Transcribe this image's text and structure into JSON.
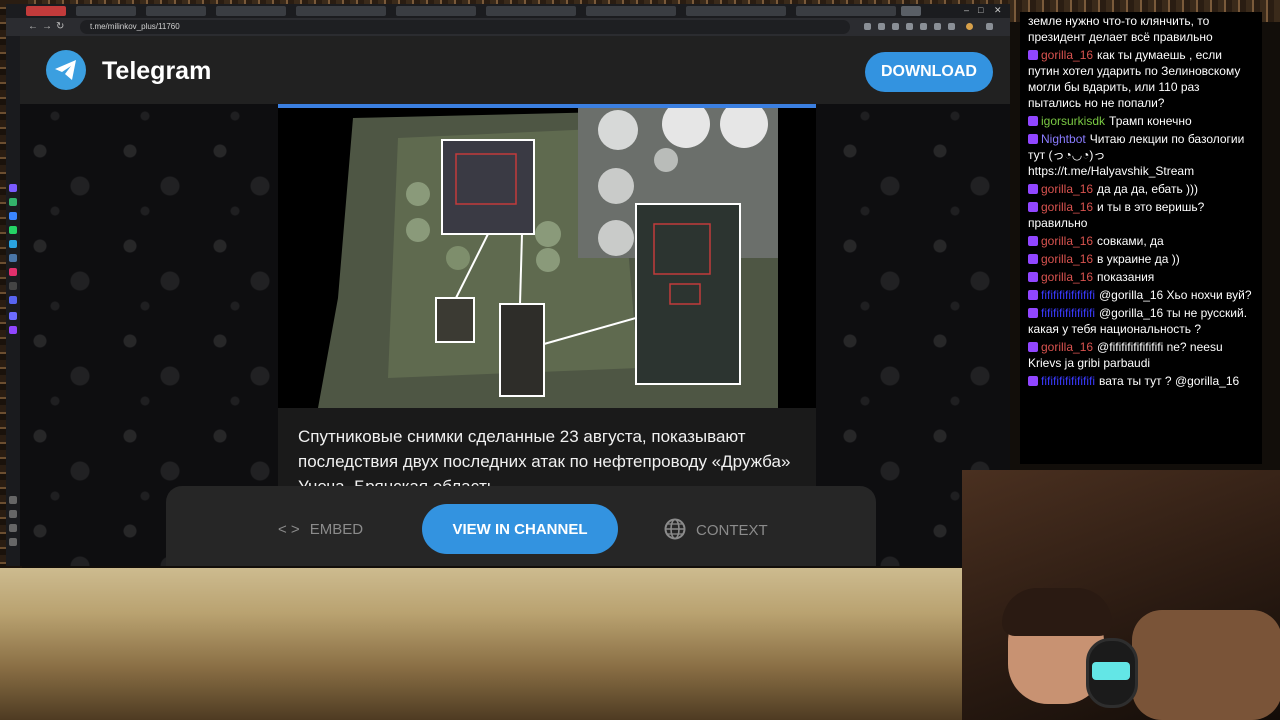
{
  "browser": {
    "url": "t.me/milinkov_plus/11760"
  },
  "telegram": {
    "brand": "Telegram",
    "download_label": "DOWNLOAD",
    "post_text": "Спутниковые снимки сделанные 23 августа, показывают последствия двух последних атак по нефтепроводу «Дружба» Унеча, Брянская область",
    "embed_label": "EMBED",
    "view_label": "VIEW IN CHANNEL",
    "context_label": "CONTEXT",
    "accent_color": "#3393e0"
  },
  "chat": {
    "messages": [
      {
        "user": "",
        "color": "#ffffff",
        "text": "земле нужно что-то клянчить, то президент делает всё правильно"
      },
      {
        "user": "gorilla_16",
        "color": "#d9534f",
        "text": "как ты думаешь , если путин хотел ударить по Зелиновскому могли бы вдарить, или 110 раз пытались но не попали?"
      },
      {
        "user": "igorsurkisdk",
        "color": "#7ac943",
        "text": "Трамп конечно"
      },
      {
        "user": "Nightbot",
        "color": "#8a7cff",
        "text": "Читаю лекции по базологии тут (っ◔◡◔)っ https://t.me/Halyavshik_Stream"
      },
      {
        "user": "gorilla_16",
        "color": "#d9534f",
        "text": "да да да, ебать )))"
      },
      {
        "user": "gorilla_16",
        "color": "#d9534f",
        "text": "и ты в это веришь? правильно"
      },
      {
        "user": "gorilla_16",
        "color": "#d9534f",
        "text": "совками, да"
      },
      {
        "user": "gorilla_16",
        "color": "#d9534f",
        "text": "в украине да ))"
      },
      {
        "user": "gorilla_16",
        "color": "#d9534f",
        "text": "показания"
      },
      {
        "user": "fififififififififi",
        "color": "#3a3aff",
        "text": "@gorilla_16 Хьо нохчи вуй?"
      },
      {
        "user": "fififififififififi",
        "color": "#3a3aff",
        "text": "@gorilla_16 ты не русский. какая у тебя национальность ?"
      },
      {
        "user": "gorilla_16",
        "color": "#d9534f",
        "text": "@fififififififififi ne? neesu Krievs ja gribi parbaudi"
      },
      {
        "user": "fififififififififi",
        "color": "#3a3aff",
        "text": "вата ты тут ? @gorilla_16"
      }
    ]
  }
}
